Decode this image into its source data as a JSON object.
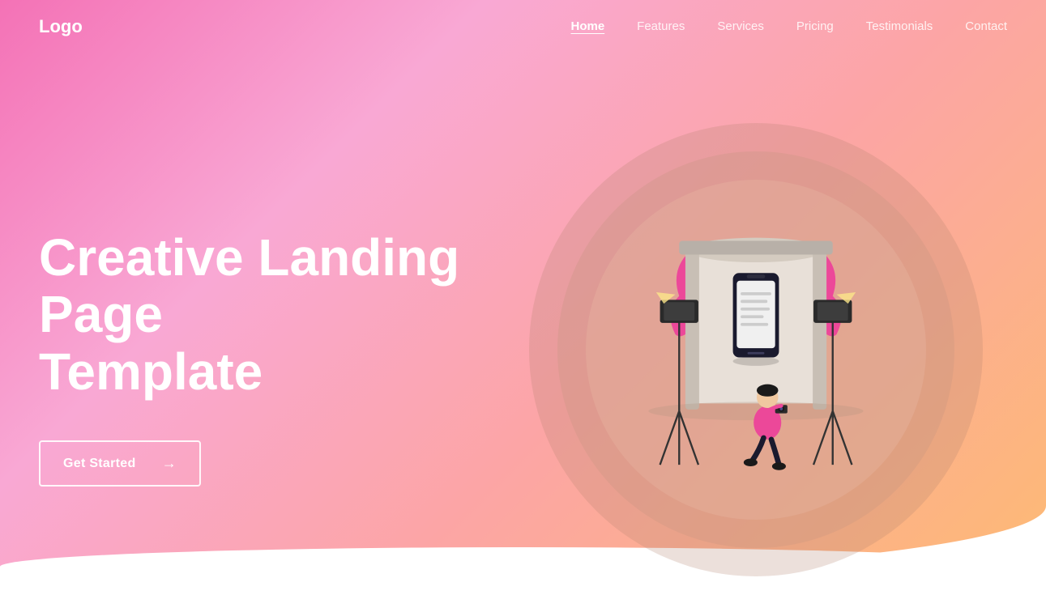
{
  "logo": {
    "text": "Logo"
  },
  "nav": {
    "items": [
      {
        "label": "Home",
        "active": true
      },
      {
        "label": "Features",
        "active": false
      },
      {
        "label": "Services",
        "active": false
      },
      {
        "label": "Pricing",
        "active": false
      },
      {
        "label": "Testimonials",
        "active": false
      },
      {
        "label": "Contact",
        "active": false
      }
    ]
  },
  "hero": {
    "title_line1": "Creative Landing Page",
    "title_line2": "Template",
    "cta_label": "Get Started",
    "cta_arrow": "→"
  },
  "colors": {
    "bg_gradient_start": "#f472b6",
    "bg_gradient_end": "#fdba74",
    "text_white": "#ffffff",
    "nav_active": "#ffffff"
  }
}
